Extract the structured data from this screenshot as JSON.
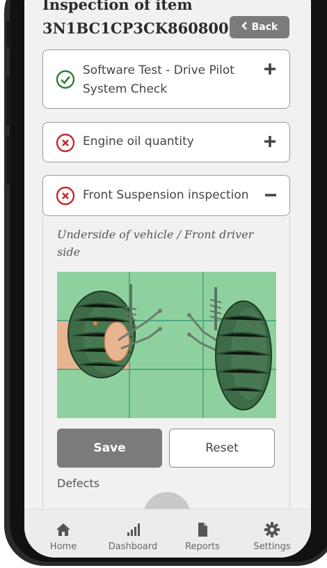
{
  "header": {
    "title_line1": "Inspection of item",
    "title_line2": "3N1BC1CP3CK860800",
    "back_label": "Back"
  },
  "items": [
    {
      "label_line1": "Software Test - Drive Pilot",
      "label_line2": "System Check",
      "status": "pass",
      "state": "collapsed"
    },
    {
      "label": "Engine oil quantity",
      "status": "fail",
      "state": "collapsed"
    },
    {
      "label": "Front Suspension inspection",
      "status": "fail",
      "state": "expanded"
    }
  ],
  "panel": {
    "location": "Underside of vehicle / Front driver side",
    "save_label": "Save",
    "reset_label": "Reset",
    "defects_label": "Defects"
  },
  "tabbar": {
    "tabs": [
      {
        "label": "Home",
        "icon": "home-icon"
      },
      {
        "label": "Dashboard",
        "icon": "bar-chart-icon"
      },
      {
        "label": "Reports",
        "icon": "document-icon"
      },
      {
        "label": "Settings",
        "icon": "gear-icon"
      }
    ]
  },
  "colors": {
    "pass": "#2e7d32",
    "fail": "#c62828",
    "button_gray": "#7b7b7b",
    "diagram_green": "#8fd19e",
    "highlight": "#e9b590"
  }
}
